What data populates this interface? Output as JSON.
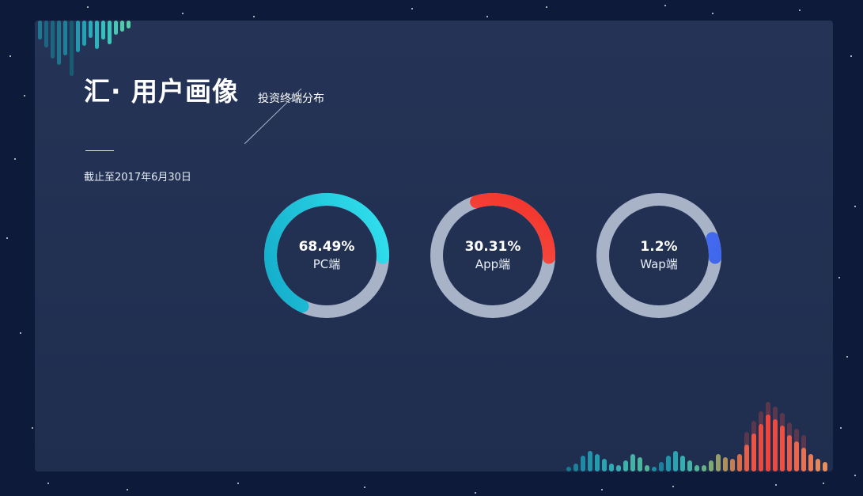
{
  "header": {
    "title": "汇· 用户画像",
    "subtitle": "投资终端分布",
    "date": "截止至2017年6月30日"
  },
  "rings": [
    {
      "value": "68.49%",
      "label": "PC端",
      "fraction": 0.6849,
      "color_start": "#33e4f0",
      "color_end": "#12a9c8"
    },
    {
      "value": "30.31%",
      "label": "App端",
      "fraction": 0.3031,
      "color_start": "#ff6a55",
      "color_end": "#f0302a"
    },
    {
      "value": "1.2%",
      "label": "Wap端",
      "fraction": 0.012,
      "color_start": "#5a7fff",
      "color_end": "#3a62e8"
    }
  ],
  "colors": {
    "background": "#0e1a3a",
    "panel": "#233253",
    "track": "#a8b3c8"
  },
  "icons": {
    "top_decoration": "equalizer-bars-icon",
    "bottom_decoration": "equalizer-bars-icon"
  }
}
